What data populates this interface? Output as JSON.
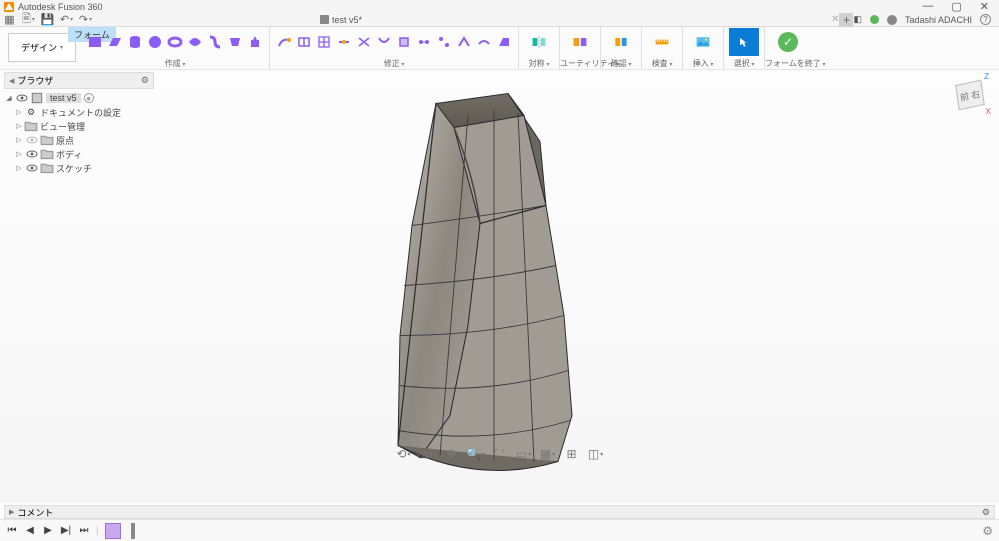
{
  "app": {
    "title": "Autodesk Fusion 360"
  },
  "window_controls": {
    "min": "—",
    "max": "▢",
    "close": "✕"
  },
  "doc_tab": {
    "title": "test v5*"
  },
  "user": {
    "name": "Tadashi ADACHI"
  },
  "workspace": {
    "label": "デザイン"
  },
  "context_tab": {
    "label": "フォーム"
  },
  "tool_groups": {
    "create": "作成",
    "modify": "修正",
    "symmetry": "対称",
    "utility": "ユーティリティ",
    "mirror": "確認",
    "measure": "検査",
    "insert": "挿入",
    "select": "選択",
    "finish": "フォームを終了"
  },
  "browser": {
    "title": "ブラウザ",
    "root": "test v5",
    "nodes": {
      "doc_settings": "ドキュメントの設定",
      "views": "ビュー管理",
      "origin": "原点",
      "bodies": "ボディ",
      "sketches": "スケッチ"
    }
  },
  "viewcube": {
    "front": "前",
    "right": "右",
    "z": "Z",
    "x": "X"
  },
  "comment_bar": {
    "label": "コメント"
  }
}
